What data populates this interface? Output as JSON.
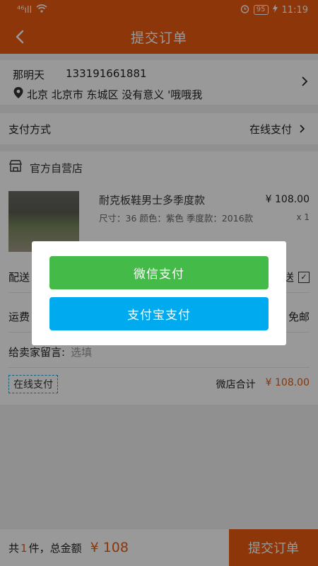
{
  "status_bar": {
    "signal": "⁴⁶ıll",
    "battery": "95",
    "time": "11:19"
  },
  "header": {
    "title": "提交订单"
  },
  "address": {
    "name": "那明天",
    "phone": "133191661881",
    "detail": "北京 北京市 东城区 没有意义 '哦哦我"
  },
  "payment_method": {
    "label": "支付方式",
    "value": "在线支付"
  },
  "store": {
    "name": "官方自营店",
    "product": {
      "name": "耐克板鞋男士多季度款",
      "price": "¥ 108.00",
      "spec": "尺寸：36  颜色：紫色  季度款：2016款",
      "qty": "x 1"
    },
    "delivery_label": "配送",
    "delivery_tail": "送",
    "ship_label": "运费",
    "ship_value": "免邮",
    "message_label": "给卖家留言:",
    "message_placeholder": "选填",
    "pay_tag": "在线支付",
    "subtotal_label": "微店合计",
    "subtotal_value": "¥ 108.00"
  },
  "dialog": {
    "wechat_label": "微信支付",
    "alipay_label": "支付宝支付"
  },
  "bottom": {
    "prefix": "共",
    "count": "1",
    "suffix": "件，总金额",
    "total": "¥ 108",
    "submit_label": "提交订单"
  }
}
